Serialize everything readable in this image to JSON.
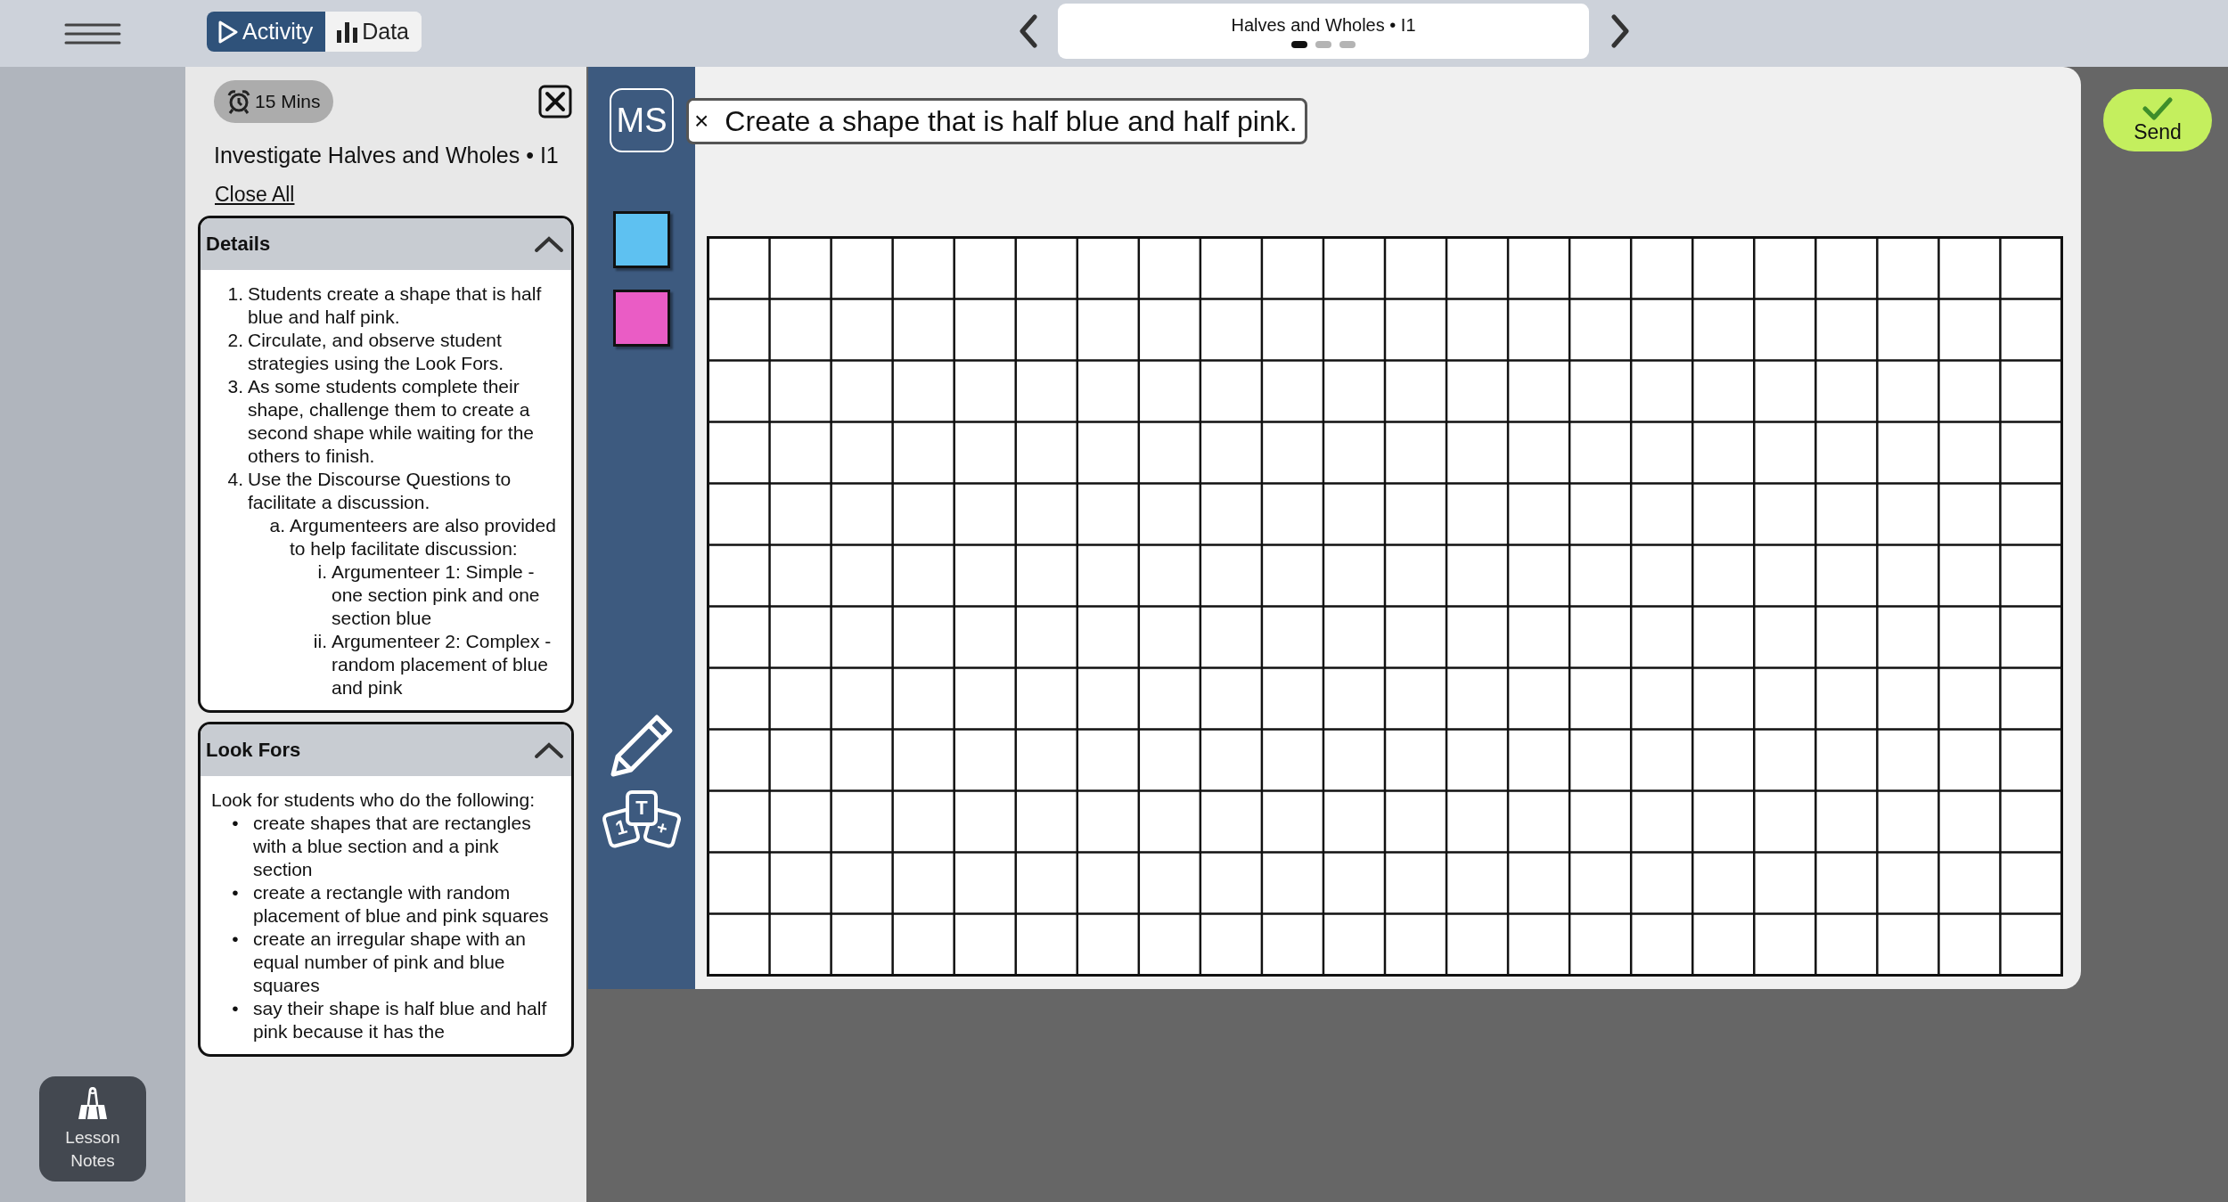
{
  "top_bar": {
    "mode_tabs": [
      {
        "label": "Activity",
        "kind": "play",
        "selected": true
      },
      {
        "label": "Data",
        "kind": "bars",
        "selected": false
      }
    ],
    "lesson_title": "Halves and Wholes • I1",
    "page_dots": [
      {
        "selected": true
      },
      {
        "selected": false
      },
      {
        "selected": false
      }
    ]
  },
  "lesson_notes_button": {
    "label": "Lesson Notes"
  },
  "notes_panel": {
    "timer": "15 Mins",
    "title": "Investigate Halves and Wholes • I1",
    "close_all": "Close All",
    "sections": [
      {
        "title": "Details",
        "expanded": true,
        "items": [
          {
            "marker": "1.",
            "text": "Students create a shape that is half blue and half pink."
          },
          {
            "marker": "2.",
            "text": "Circulate, and observe student strategies using the Look Fors."
          },
          {
            "marker": "3.",
            "text": "As some students complete their shape, challenge them to create a second shape while waiting for the others to finish."
          },
          {
            "marker": "4.",
            "text": "Use the Discourse Questions to facilitate a discussion.",
            "children": [
              {
                "marker": "a.",
                "text": "Argumenteers are also provided to help facilitate discussion:",
                "children": [
                  {
                    "marker": "i.",
                    "text": "Argumenteer 1: Simple - one section pink and one section blue"
                  },
                  {
                    "marker": "ii.",
                    "text": "Argumenteer 2: Complex - random placement of blue and pink"
                  }
                ]
              }
            ]
          }
        ]
      },
      {
        "title": "Look Fors",
        "expanded": true,
        "intro": "Look for students who do the following:",
        "items": [
          {
            "marker": "•",
            "text": "create shapes that are rectangles with a blue section and a pink section"
          },
          {
            "marker": "•",
            "text": "create a rectangle with random placement of blue and pink squares"
          },
          {
            "marker": "•",
            "text": "create an irregular shape with an equal number of pink and blue squares"
          },
          {
            "marker": "•",
            "text": "say their shape is half blue and half pink because it has the"
          }
        ]
      }
    ]
  },
  "activity": {
    "avatar": "MS",
    "prompt_close": "×",
    "prompt": "Create a shape that is half blue and half pink.",
    "tools": [
      {
        "kind": "swatch",
        "color": "#5ec1f1"
      },
      {
        "kind": "swatch",
        "color": "#ea5cc5"
      },
      {
        "kind": "pencil"
      },
      {
        "kind": "number_tiles",
        "labels": [
          "1",
          "T",
          "+"
        ]
      }
    ]
  },
  "send_button": {
    "label": "Send"
  }
}
